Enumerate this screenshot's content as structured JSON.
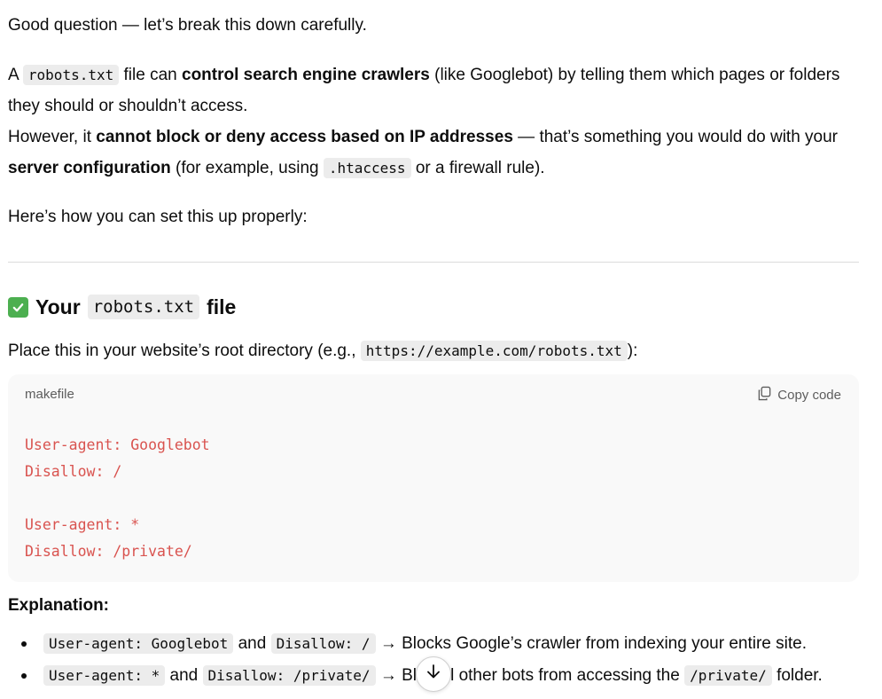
{
  "intro": "Good question — let’s break this down carefully.",
  "para2": {
    "a": "A",
    "code_robots": "robots.txt",
    "b": "file can",
    "bold_control": "control search engine crawlers",
    "c": "(like Googlebot) by telling them which pages or folders they should or shouldn’t access.",
    "d": "However, it",
    "bold_cannot": "cannot block or deny access based on IP addresses",
    "e": "— that’s something you would do with your",
    "bold_server": "server configuration",
    "f": "(for example, using",
    "code_htaccess": ".htaccess",
    "g": "or a firewall rule)."
  },
  "para3": "Here’s how you can set this up properly:",
  "section": {
    "heading_prefix": "Your",
    "heading_code": "robots.txt",
    "heading_suffix": "file",
    "place_text": "Place this in your website’s root directory (e.g.,",
    "place_code": "https://example.com/robots.txt",
    "place_end": "):"
  },
  "codeblock": {
    "language": "makefile",
    "copy_label": "Copy code",
    "code": "User-agent: Googlebot\nDisallow: /\n\nUser-agent: *\nDisallow: /private/"
  },
  "explanation": {
    "heading": "Explanation:",
    "item1": {
      "code1": "User-agent: Googlebot",
      "and": "and",
      "code2": "Disallow: /",
      "text": "→ Blocks Google’s crawler from indexing your entire site."
    },
    "item2": {
      "code1": "User-agent: *",
      "and": "and",
      "code2": "Disallow: /private/",
      "text_a": "→ Bl",
      "text_b": "all other bots from accessing the",
      "code3": "/private/",
      "text_c": "folder."
    }
  },
  "colors": {
    "code_text": "#d9534f",
    "check_bg": "#4caf50"
  }
}
